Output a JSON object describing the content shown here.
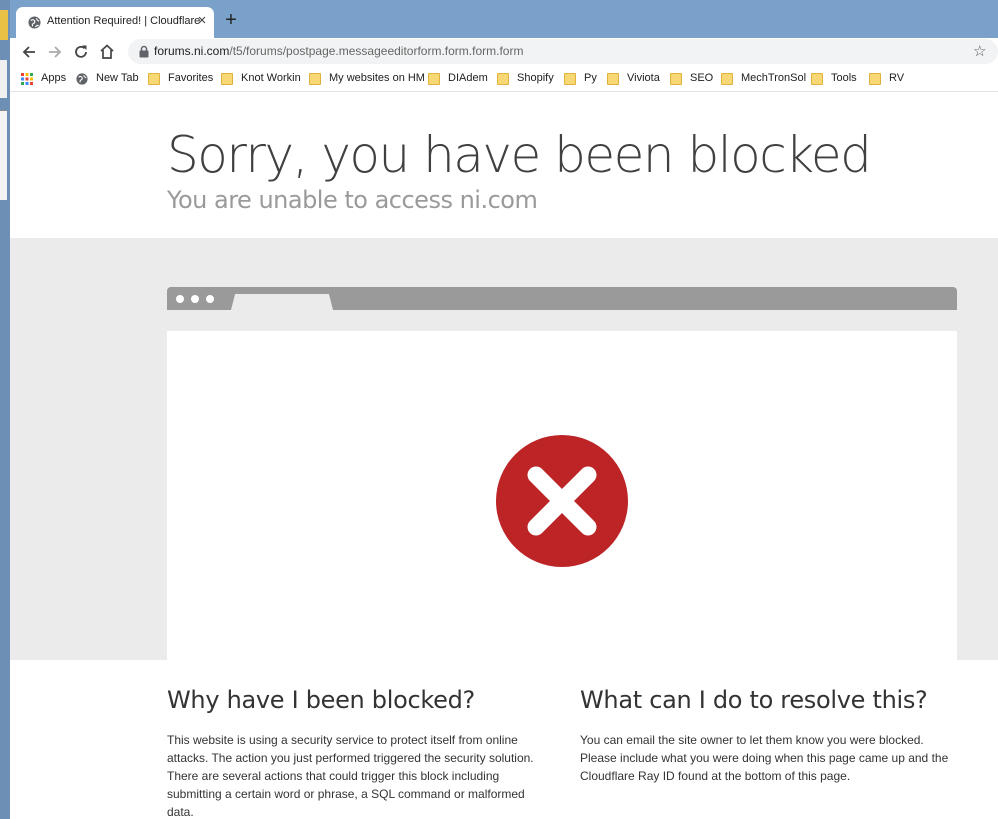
{
  "browser": {
    "tab_title": "Attention Required! | Cloudflare",
    "tab_close": "×",
    "new_tab": "+",
    "url_host": "forums.ni.com",
    "url_path": "/t5/forums/postpage.messageeditorform.form.form.form"
  },
  "bookmarks": [
    {
      "label": "Apps",
      "icon": "apps-grid-icon"
    },
    {
      "label": "New Tab",
      "icon": "globe-icon"
    },
    {
      "label": "Favorites",
      "icon": "folder-icon"
    },
    {
      "label": "Knot Workin",
      "icon": "folder-icon"
    },
    {
      "label": "My websites on HM",
      "icon": "folder-icon"
    },
    {
      "label": "DIAdem",
      "icon": "folder-icon"
    },
    {
      "label": "Shopify",
      "icon": "folder-icon"
    },
    {
      "label": "Py",
      "icon": "folder-icon"
    },
    {
      "label": "Viviota",
      "icon": "folder-icon"
    },
    {
      "label": "SEO",
      "icon": "folder-icon"
    },
    {
      "label": "MechTronSol",
      "icon": "folder-icon"
    },
    {
      "label": "Tools",
      "icon": "folder-icon"
    },
    {
      "label": "RV",
      "icon": "folder-icon"
    }
  ],
  "page": {
    "headline": "Sorry, you have been blocked",
    "subline": "You are unable to access ni.com",
    "why_title": "Why have I been blocked?",
    "why_body": "This website is using a security service to protect itself from online attacks. The action you just performed triggered the security solution. There are several actions that could trigger this block including submitting a certain word or phrase, a SQL command or malformed data.",
    "resolve_title": "What can I do to resolve this?",
    "resolve_body": "You can email the site owner to let them know you were blocked. Please include what you were doing when this page came up and the Cloudflare Ray ID found at the bottom of this page."
  },
  "colors": {
    "error_red": "#bd2426",
    "titlebar_blue": "#7aa1c9",
    "gray_panel": "#ebebeb"
  }
}
